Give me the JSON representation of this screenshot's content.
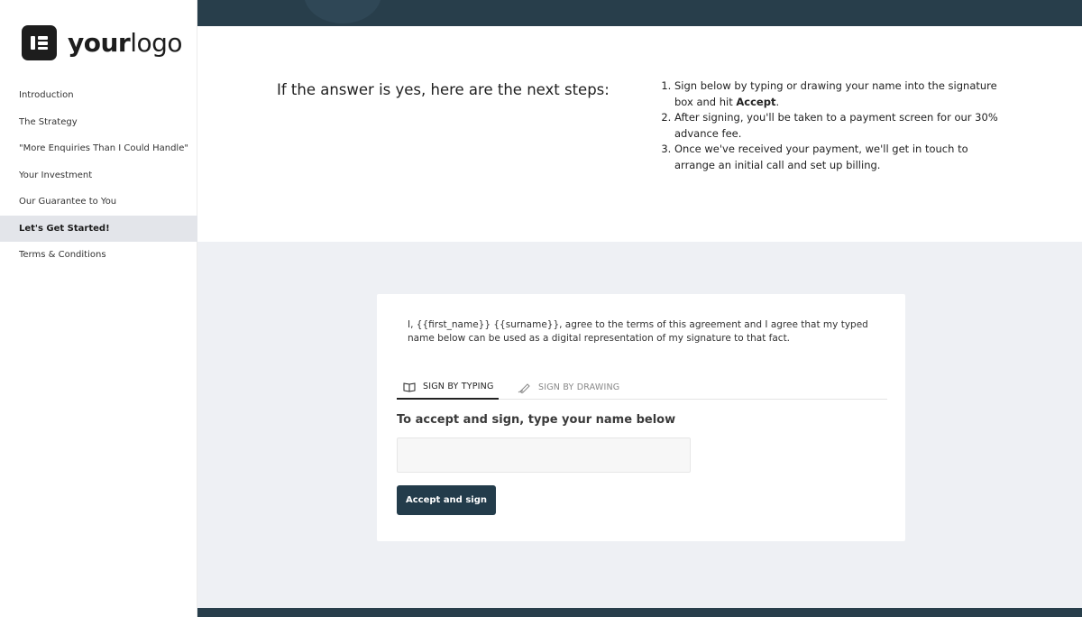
{
  "logo": {
    "text_bold": "your",
    "text_light": "logo"
  },
  "sidebar": {
    "items": [
      {
        "label": "Introduction"
      },
      {
        "label": "The Strategy"
      },
      {
        "label": "\"More Enquiries Than I Could Handle\""
      },
      {
        "label": "Your Investment"
      },
      {
        "label": "Our Guarantee to You"
      },
      {
        "label": "Let's Get Started!",
        "active": true
      },
      {
        "label": "Terms & Conditions"
      }
    ]
  },
  "next_steps": {
    "headline": "If the answer is yes, here are the next steps:",
    "step1_text": "Sign below by typing or drawing your name into the signature box and hit ",
    "step1_bold": "Accept",
    "step1_end": ".",
    "step2": "After signing, you'll be taken to a payment screen for our 30% advance fee.",
    "step3": "Once we've received your payment, we'll get in touch to arrange an initial call and set up billing."
  },
  "signature": {
    "agreement": "I, {{first_name}} {{surname}}, agree to the terms of this agreement and I agree that my typed name below can be used as a digital representation of my signature to that fact.",
    "tab_typing": "SIGN BY TYPING",
    "tab_drawing": "SIGN BY DRAWING",
    "label": "To accept and sign, type your name below",
    "input_value": "",
    "button": "Accept and sign"
  },
  "colors": {
    "navy": "#283e4b",
    "button": "#233c4b",
    "active_nav_bg": "#e3e5ea",
    "section_bg": "#eef0f4"
  }
}
